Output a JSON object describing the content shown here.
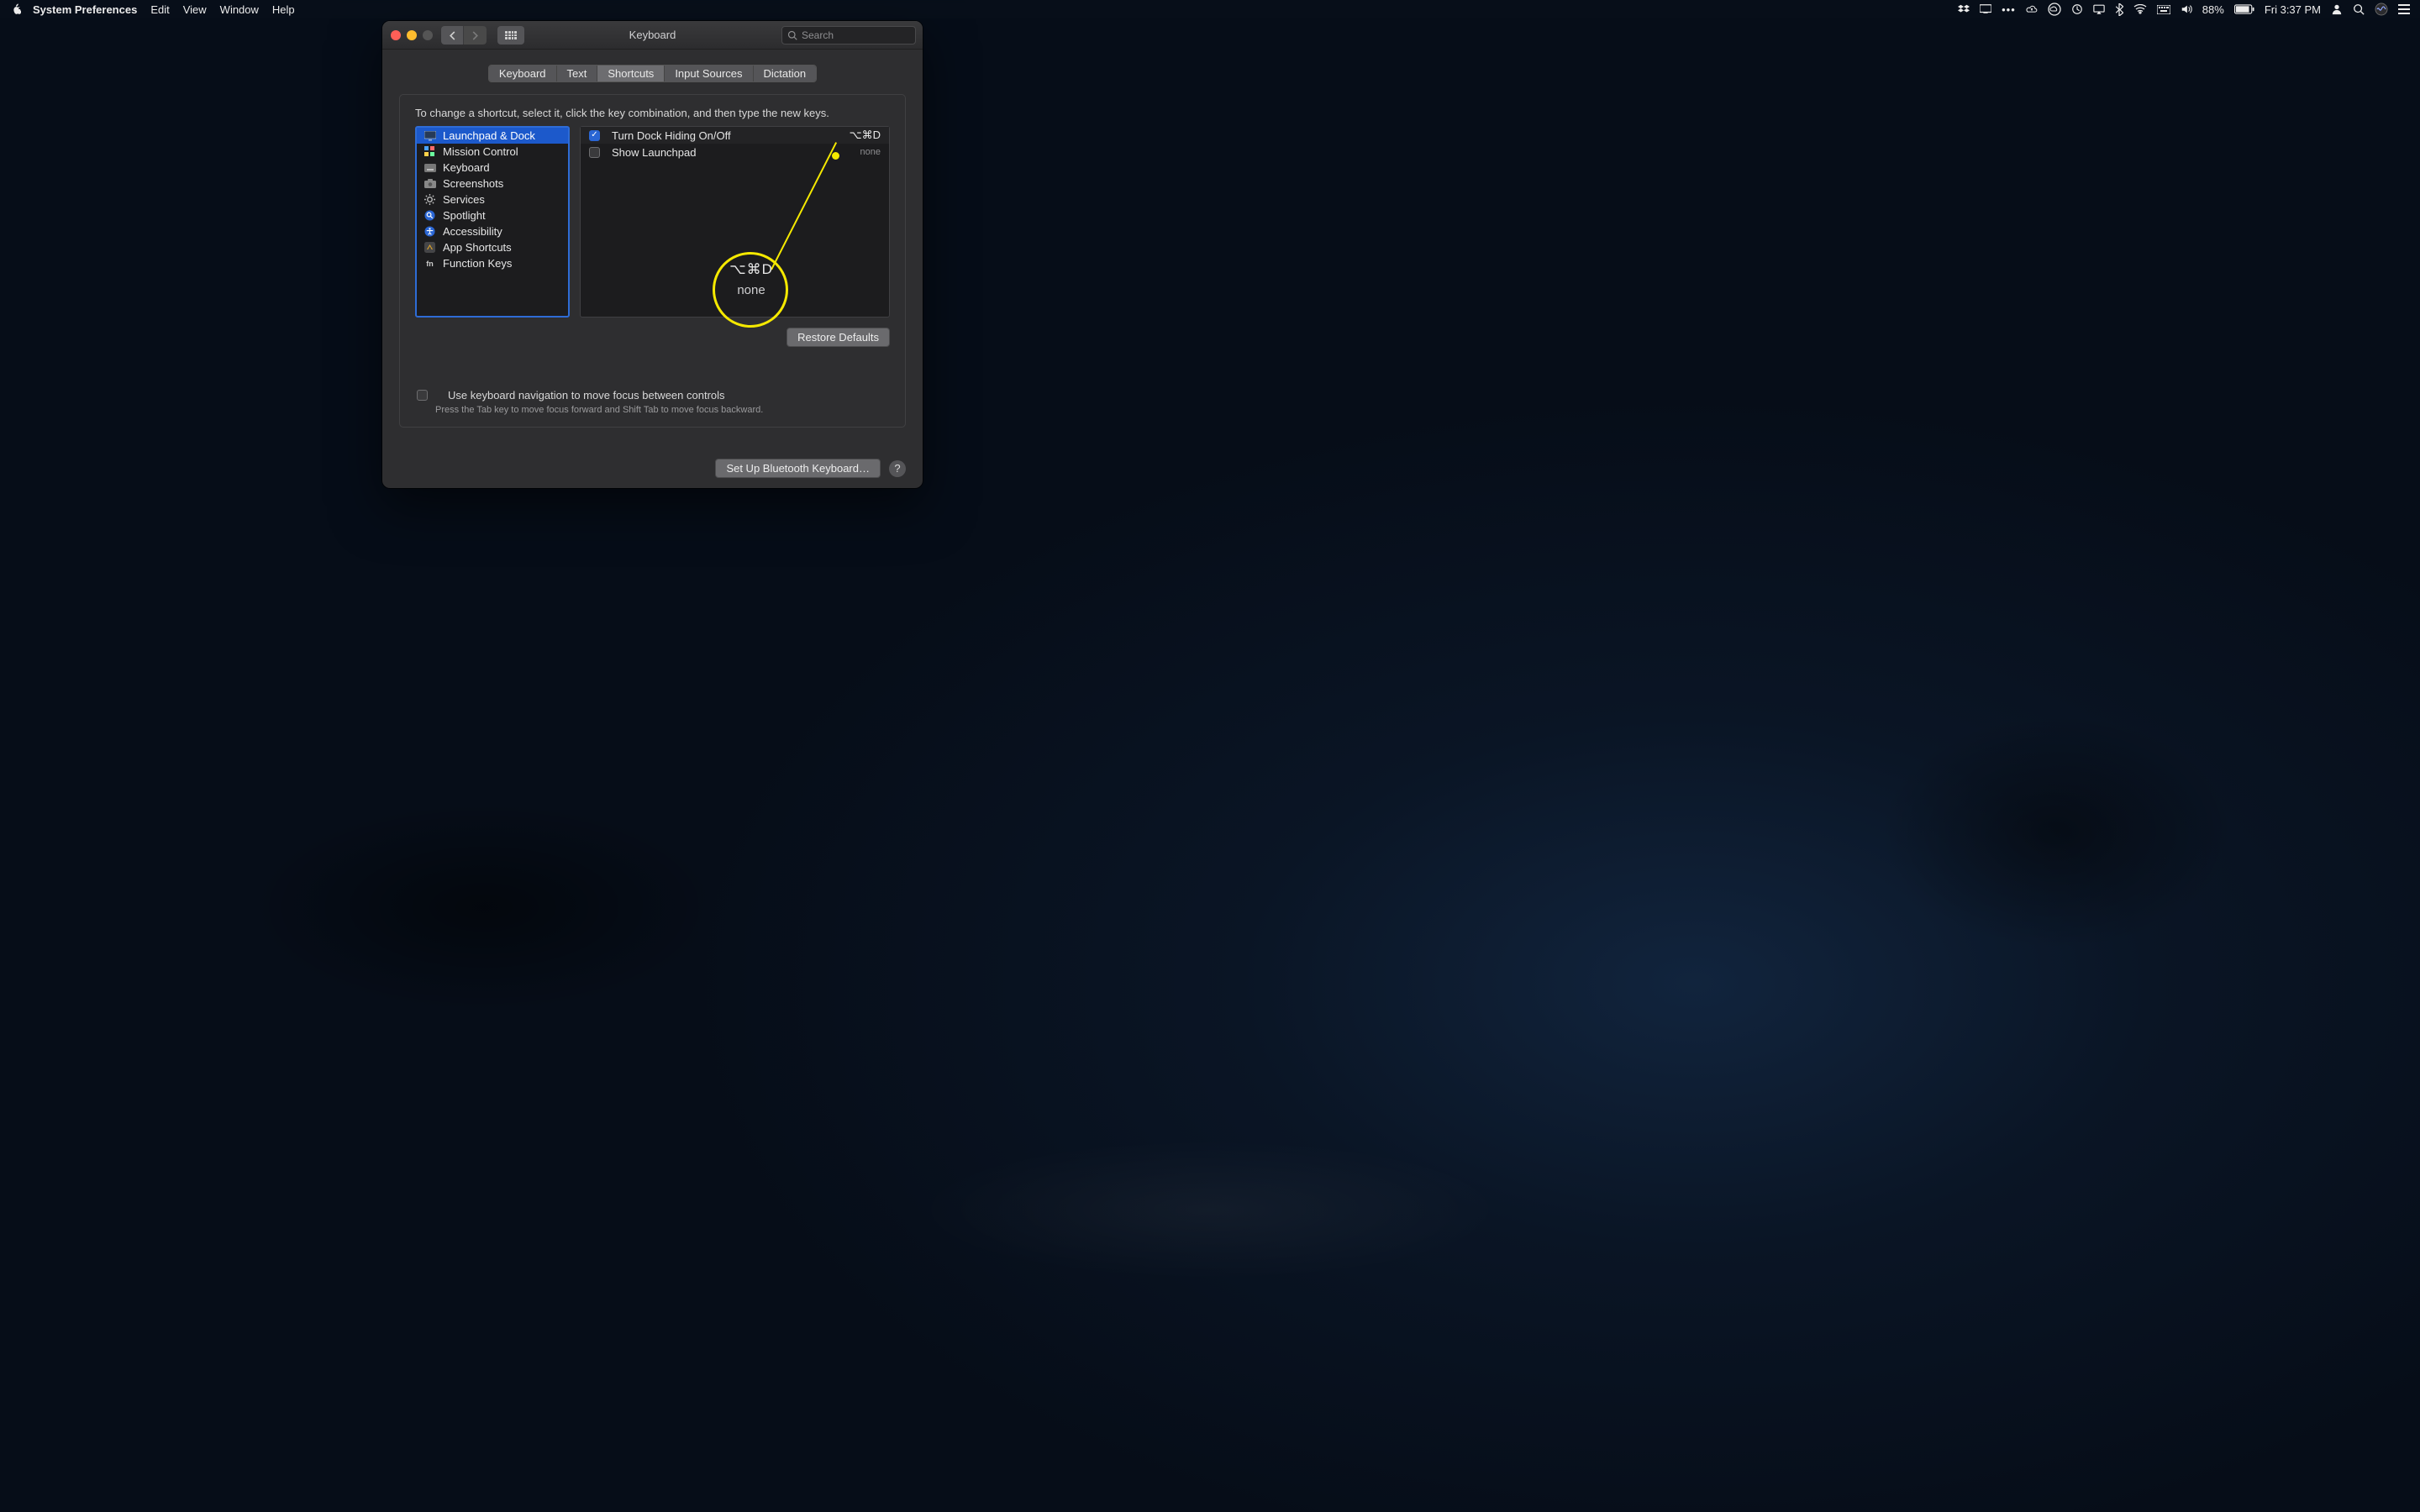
{
  "menubar": {
    "app": "System Preferences",
    "items": [
      "Edit",
      "View",
      "Window",
      "Help"
    ],
    "battery_pct": "88%",
    "clock": "Fri 3:37 PM"
  },
  "window": {
    "title": "Keyboard",
    "search_placeholder": "Search"
  },
  "tabs": [
    "Keyboard",
    "Text",
    "Shortcuts",
    "Input Sources",
    "Dictation"
  ],
  "tabs_active_index": 2,
  "instruction": "To change a shortcut, select it, click the key combination, and then type the new keys.",
  "categories": [
    {
      "label": "Launchpad & Dock",
      "icon": "display-icon",
      "selected": true
    },
    {
      "label": "Mission Control",
      "icon": "grid-color-icon"
    },
    {
      "label": "Keyboard",
      "icon": "keyboard-icon"
    },
    {
      "label": "Screenshots",
      "icon": "camera-icon"
    },
    {
      "label": "Services",
      "icon": "gear-icon"
    },
    {
      "label": "Spotlight",
      "icon": "search-blue-icon"
    },
    {
      "label": "Accessibility",
      "icon": "accessibility-icon"
    },
    {
      "label": "App Shortcuts",
      "icon": "app-icon"
    },
    {
      "label": "Function Keys",
      "icon": "fn-icon"
    }
  ],
  "shortcuts": [
    {
      "checked": true,
      "label": "Turn Dock Hiding On/Off",
      "keys": "⌥⌘D"
    },
    {
      "checked": false,
      "label": "Show Launchpad",
      "keys": "none",
      "dim": true
    }
  ],
  "buttons": {
    "restore": "Restore Defaults",
    "bluetooth": "Set Up Bluetooth Keyboard…"
  },
  "kb_nav": {
    "label": "Use keyboard navigation to move focus between controls",
    "hint": "Press the Tab key to move focus forward and Shift Tab to move focus backward."
  },
  "callout": {
    "top": "⌥⌘D",
    "bottom": "none"
  }
}
